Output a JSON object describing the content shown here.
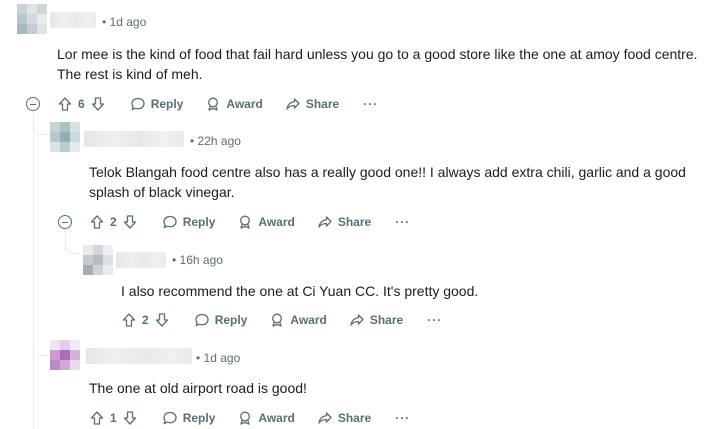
{
  "colors": {
    "meta": "#576f76",
    "text": "#1c1c1c",
    "line": "#e5ebee"
  },
  "comments": [
    {
      "time": "• 1d ago",
      "body": "Lor mee is the kind of food that fail hard unless you go to a good store like the one at amoy food centre. The rest is kind of meh.",
      "votes": "6",
      "reply": "Reply",
      "award": "Award",
      "share": "Share",
      "more": "···"
    },
    {
      "time": "• 22h ago",
      "body": "Telok Blangah food centre also has a really good one!! I always add extra chili, garlic and a good splash of black vinegar.",
      "votes": "2",
      "reply": "Reply",
      "award": "Award",
      "share": "Share",
      "more": "···"
    },
    {
      "time": "• 16h ago",
      "body": "I also recommend the one at Ci Yuan CC. It's pretty good.",
      "votes": "2",
      "reply": "Reply",
      "award": "Award",
      "share": "Share",
      "more": "···"
    },
    {
      "time": "• 1d ago",
      "body": "The one at old airport road is good!",
      "votes": "1",
      "reply": "Reply",
      "award": "Award",
      "share": "Share",
      "more": "···"
    }
  ]
}
